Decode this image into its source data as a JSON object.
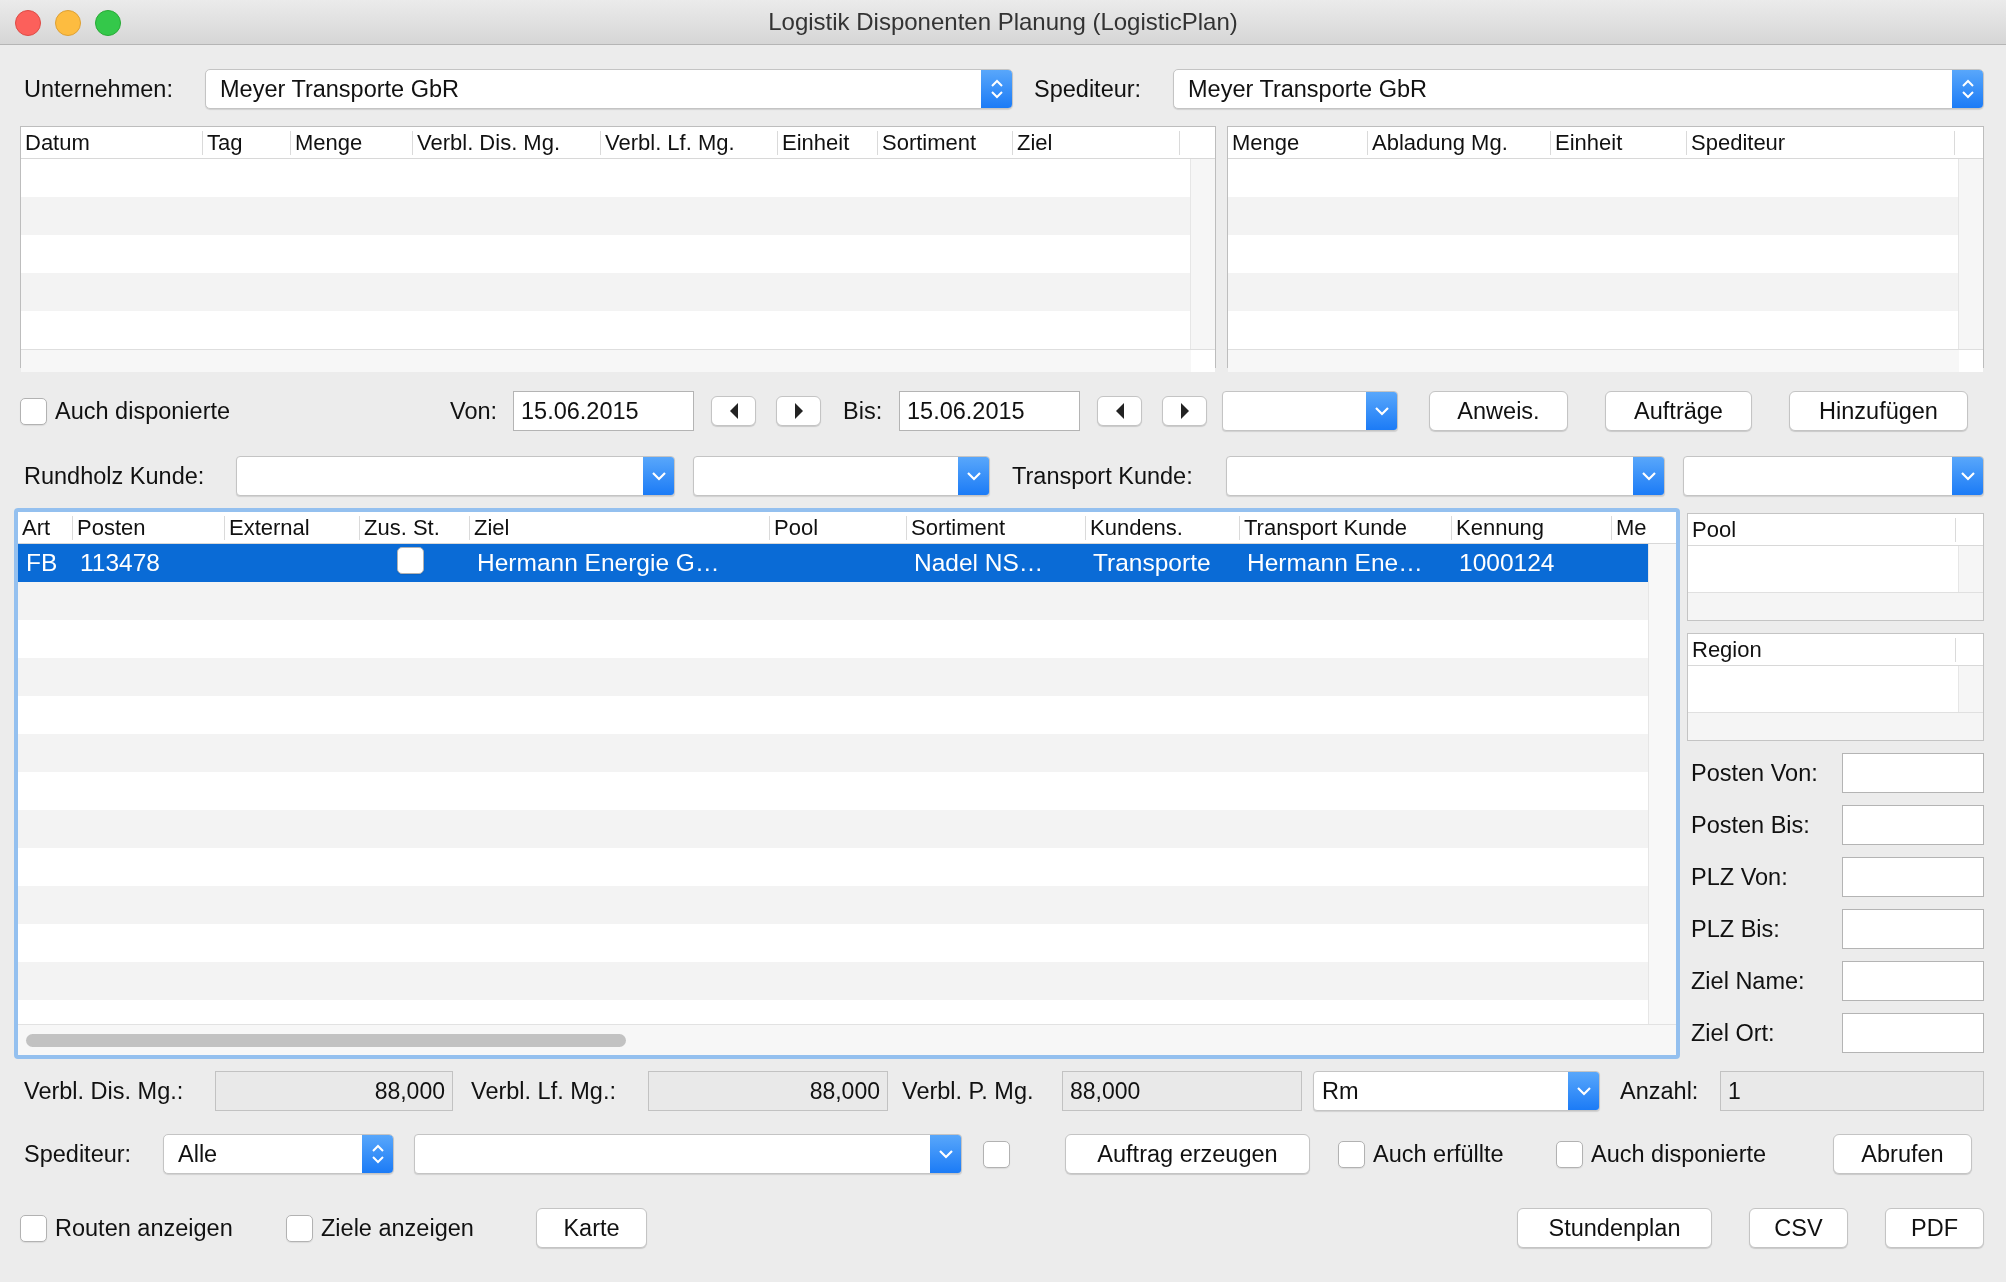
{
  "window": {
    "title": "Logistik Disponenten Planung (LogisticPlan)"
  },
  "company": {
    "label": "Unternehmen:",
    "value": "Meyer Transporte GbR"
  },
  "carrier": {
    "label": "Spediteur:",
    "value": "Meyer Transporte GbR"
  },
  "orders_table": {
    "columns": [
      "Datum",
      "Tag",
      "Menge",
      "Verbl. Dis. Mg.",
      "Verbl. Lf. Mg.",
      "Einheit",
      "Sortiment",
      "Ziel"
    ]
  },
  "unloading_table": {
    "columns": [
      "Menge",
      "Abladung Mg.",
      "Einheit",
      "Spediteur"
    ]
  },
  "date_filter": {
    "include_dispatched": {
      "label": "Auch disponierte",
      "checked": false
    },
    "from_label": "Von:",
    "from": "15.06.2015",
    "to_label": "Bis:",
    "to": "15.06.2015"
  },
  "toolbar_buttons": [
    "Anweis.",
    "Aufträge",
    "Hinzufügen"
  ],
  "customer_filter": {
    "roundwood_label": "Rundholz Kunde:",
    "transport_label": "Transport Kunde:"
  },
  "main_table": {
    "columns": [
      "Art",
      "Posten",
      "External",
      "Zus. St.",
      "Ziel",
      "Pool",
      "Sortiment",
      "Kundens.",
      "Transport Kunde",
      "Kennung",
      "Me"
    ],
    "rows": [
      {
        "art": "FB",
        "posten": "113478",
        "zus_st_checked": false,
        "ziel": "Hermann Energie G…",
        "sortiment": "Nadel NS…",
        "kundens": "Transporte",
        "transport_kunde": "Hermann Ene…",
        "kennung": "1000124",
        "selected": true
      }
    ]
  },
  "side_panel": {
    "pool_table": {
      "columns": [
        "Pool"
      ]
    },
    "region_table": {
      "columns": [
        "Region"
      ]
    },
    "filters": [
      {
        "label": "Posten Von:"
      },
      {
        "label": "Posten Bis:"
      },
      {
        "label": "PLZ Von:"
      },
      {
        "label": "PLZ Bis:"
      },
      {
        "label": "Ziel Name:"
      },
      {
        "label": "Ziel Ort:"
      }
    ]
  },
  "totals": {
    "remaining_dispatch": {
      "label": "Verbl. Dis. Mg.:",
      "value": "88,000"
    },
    "remaining_delivery": {
      "label": "Verbl. Lf. Mg.:",
      "value": "88,000"
    },
    "remaining_p": {
      "label": "Verbl. P. Mg.",
      "value": "88,000"
    },
    "unit": {
      "value": "Rm"
    },
    "count": {
      "label": "Anzahl:",
      "value": "1"
    }
  },
  "dispatch": {
    "carrier_label": "Spediteur:",
    "carrier_value": "Alle",
    "extra_checked": false,
    "create_button": "Auftrag erzeugen",
    "options": [
      {
        "label": "Auch erfüllte",
        "checked": false
      },
      {
        "label": "Auch disponierte",
        "checked": false
      }
    ],
    "fetch_button": "Abrufen"
  },
  "footer": {
    "options": [
      {
        "label": "Routen anzeigen",
        "checked": false
      },
      {
        "label": "Ziele anzeigen",
        "checked": false
      }
    ],
    "map_button": "Karte",
    "buttons": [
      "Stundenplan",
      "CSV",
      "PDF"
    ]
  }
}
